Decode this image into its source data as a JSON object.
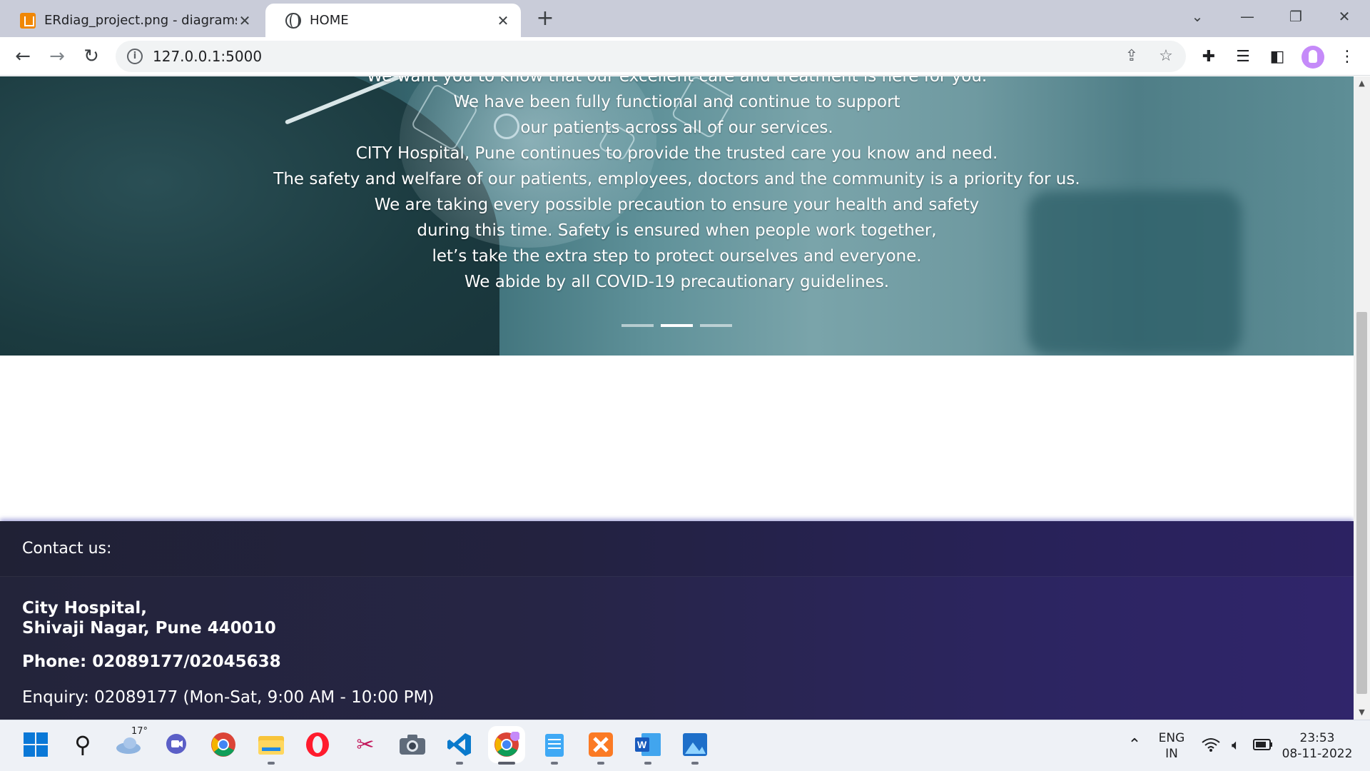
{
  "browser": {
    "tabs": [
      {
        "title": "ERdiag_project.png - diagrams.net",
        "favicon": "drawio-icon",
        "active": false
      },
      {
        "title": "HOME",
        "favicon": "globe-icon",
        "active": true
      }
    ],
    "new_tab": "+",
    "window_controls": {
      "dropdown": "⌄",
      "minimize": "—",
      "restore": "❐",
      "close": "✕"
    },
    "url": "127.0.0.1:5000"
  },
  "hero": {
    "lines": [
      "We want you to know that our excellent care and treatment is here for you.",
      "We have been fully functional and continue to support",
      "our patients across all of our services.",
      "CITY Hospital, Pune continues to provide the trusted care you know and need.",
      "The safety and welfare of our patients, employees, doctors and the community is a priority for us.",
      "We are taking every possible precaution to ensure your health and safety",
      "during this time. Safety is ensured when people work together,",
      "let’s take the extra step to protect ourselves and everyone.",
      "We abide by all COVID-19 precautionary guidelines."
    ],
    "slide_count": 3,
    "active_slide": 2
  },
  "footer": {
    "heading": "Contact us:",
    "address_line1": "City Hospital,",
    "address_line2": "Shivaji Nagar, Pune 440010",
    "phone": "Phone: 02089177/02045638",
    "enquiry": "Enquiry: 02089177 (Mon-Sat, 9:00 AM - 10:00 PM)"
  },
  "taskbar": {
    "weather_temp": "17°",
    "language_line1": "ENG",
    "language_line2": "IN",
    "time": "23:53",
    "date": "08-11-2022"
  },
  "colors": {
    "footer_start": "#23243a",
    "footer_end": "#30256b",
    "tabstrip": "#c9ccd9",
    "hero_teal": "#5f9199"
  }
}
